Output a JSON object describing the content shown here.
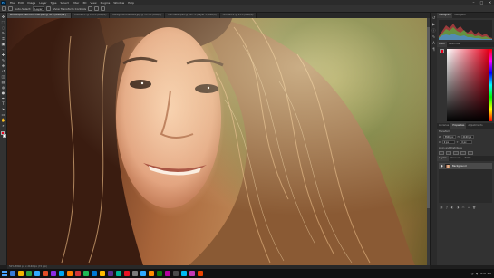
{
  "app": {
    "logo": "Ps"
  },
  "menubar": {
    "items": [
      "File",
      "Edit",
      "Image",
      "Layer",
      "Type",
      "Select",
      "Filter",
      "3D",
      "View",
      "Plugins",
      "Window",
      "Help"
    ],
    "window_controls": [
      "minimize-icon",
      "maximize-icon",
      "close-icon"
    ]
  },
  "options_bar": {
    "labels": [
      "Auto-Select:",
      "Layer",
      "Show Transform Controls"
    ],
    "field_value": "Layer"
  },
  "tabs": [
    {
      "label": "woman-portrait-curly-hair.psd @ 50% (RGB/8#) *",
      "active": true
    },
    {
      "label": "Untitled-1 @ 100% (RGB/8)",
      "active": false
    },
    {
      "label": "background-texture.jpg @ 33.3% (RGB/8)",
      "active": false
    },
    {
      "label": "hair-detail.psd @ 66.7% (Layer 1, RGB/8)",
      "active": false
    },
    {
      "label": "Untitled-2 @ 25% (RGB/8)",
      "active": false
    }
  ],
  "tools": [
    "move-icon",
    "marquee-icon",
    "lasso-icon",
    "quick-select-icon",
    "crop-icon",
    "frame-icon",
    "eyedropper-icon",
    "healing-brush-icon",
    "brush-icon",
    "clone-stamp-icon",
    "history-brush-icon",
    "eraser-icon",
    "gradient-icon",
    "blur-icon",
    "dodge-icon",
    "pen-icon",
    "type-icon",
    "path-select-icon",
    "rectangle-icon",
    "hand-icon",
    "zoom-icon"
  ],
  "tool_glyphs": [
    "✥",
    "⬚",
    "◌",
    "✎",
    "⌗",
    "▣",
    "⌁",
    "✚",
    "✎",
    "⎈",
    "↺",
    "◫",
    "▤",
    "◍",
    "●",
    "✒",
    "T",
    "➤",
    "▭",
    "✋",
    "⌕"
  ],
  "colors": {
    "foreground": "#e8001c",
    "background": "#ffffff",
    "accent": "#31a8ff"
  },
  "right_panels": {
    "top_tabs": [
      "Histogram",
      "Navigator"
    ],
    "color_tabs": [
      "Color",
      "Swatches"
    ],
    "properties_tabs": [
      "Libraries",
      "Properties",
      "Adjustments"
    ],
    "properties": {
      "section": "Transform",
      "rows": [
        {
          "label": "W",
          "value": "3840 px"
        },
        {
          "label": "H",
          "value": "2160 px"
        },
        {
          "label": "X",
          "value": "0 px"
        },
        {
          "label": "Y",
          "value": "0 px"
        }
      ],
      "align_section": "Align and Distribute"
    },
    "layers_tabs": [
      "Layers",
      "Channels",
      "Paths"
    ],
    "layers": [
      {
        "name": "Background"
      }
    ]
  },
  "rail_icons": [
    "history-icon",
    "actions-icon",
    "info-icon",
    "brush-settings-icon",
    "character-icon",
    "paragraph-icon"
  ],
  "status": {
    "text": "50%    3840 px x 2160 px (72 ppi)"
  },
  "taskbar": {
    "apps": [
      "#3a7bd5",
      "#f5b400",
      "#2ea043",
      "#31a8ff",
      "#e34c26",
      "#8a2be2",
      "#00a4ef",
      "#ff7f00",
      "#d13438",
      "#1db954",
      "#0078d4",
      "#ffb900",
      "#5c2d91",
      "#00b294",
      "#e81123",
      "#7a7a7a",
      "#31a8ff",
      "#ff8c00",
      "#107c10",
      "#b4009e",
      "#4a4a4a",
      "#00bcf2",
      "#c239b3",
      "#ea4300"
    ],
    "time": "4:37 PM"
  }
}
